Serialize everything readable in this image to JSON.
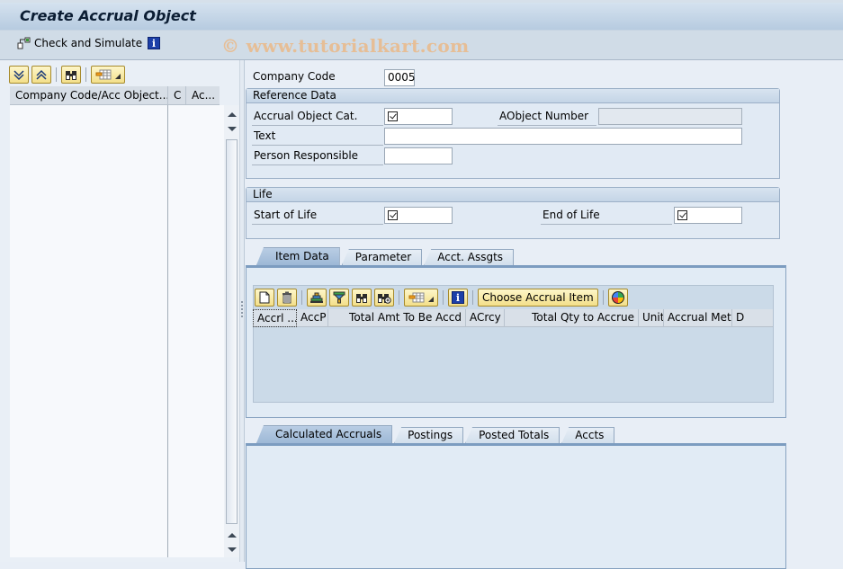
{
  "window": {
    "title": "Create Accrual Object"
  },
  "app_toolbar": {
    "check_simulate_label": "Check and Simulate",
    "info_icon": "info-icon",
    "watermark": "© www.tutorialkart.com"
  },
  "tree": {
    "toolbar": [
      "expand-all-icon",
      "collapse-all-icon",
      "find-icon",
      "layout-icon"
    ],
    "columns": [
      "Company Code/Acc Object...",
      "C",
      "Ac..."
    ]
  },
  "form": {
    "company_code": {
      "label": "Company Code",
      "value": "0005"
    },
    "reference_data": {
      "title": "Reference Data",
      "accrual_object_cat": {
        "label": "Accrual Object Cat.",
        "value": "",
        "required_checkbox": true
      },
      "aobject_number": {
        "label": "AObject Number",
        "value": ""
      },
      "text": {
        "label": "Text",
        "value": ""
      },
      "person_responsible": {
        "label": "Person Responsible",
        "value": ""
      }
    },
    "life": {
      "title": "Life",
      "start_of_life": {
        "label": "Start of Life",
        "value": "",
        "required_checkbox": true
      },
      "end_of_life": {
        "label": "End of Life",
        "value": "",
        "required_checkbox": true
      }
    }
  },
  "item_tabs": {
    "tabs": [
      {
        "label": "Item Data",
        "active": true
      },
      {
        "label": "Parameter",
        "active": false
      },
      {
        "label": "Acct. Assgts",
        "active": false
      }
    ],
    "toolbar": {
      "icons": [
        "new-document-icon",
        "delete-icon",
        "sort-ascending-icon",
        "filter-icon",
        "find-icon",
        "find-next-icon",
        "layout-icon",
        "info-icon"
      ],
      "choose_button_label": "Choose Accrual Item",
      "color-icon": "color-wheel-icon"
    },
    "grid_columns": [
      "Accrl ...",
      "AccP",
      "Total Amt To Be Accd",
      "ACrcy",
      "Total Qty to Accrue",
      "Unit",
      "Accrual Meth",
      "D"
    ],
    "rows": []
  },
  "result_tabs": {
    "tabs": [
      {
        "label": "Calculated Accruals",
        "active": true
      },
      {
        "label": "Postings",
        "active": false
      },
      {
        "label": "Posted Totals",
        "active": false
      },
      {
        "label": "Accts",
        "active": false
      }
    ]
  }
}
